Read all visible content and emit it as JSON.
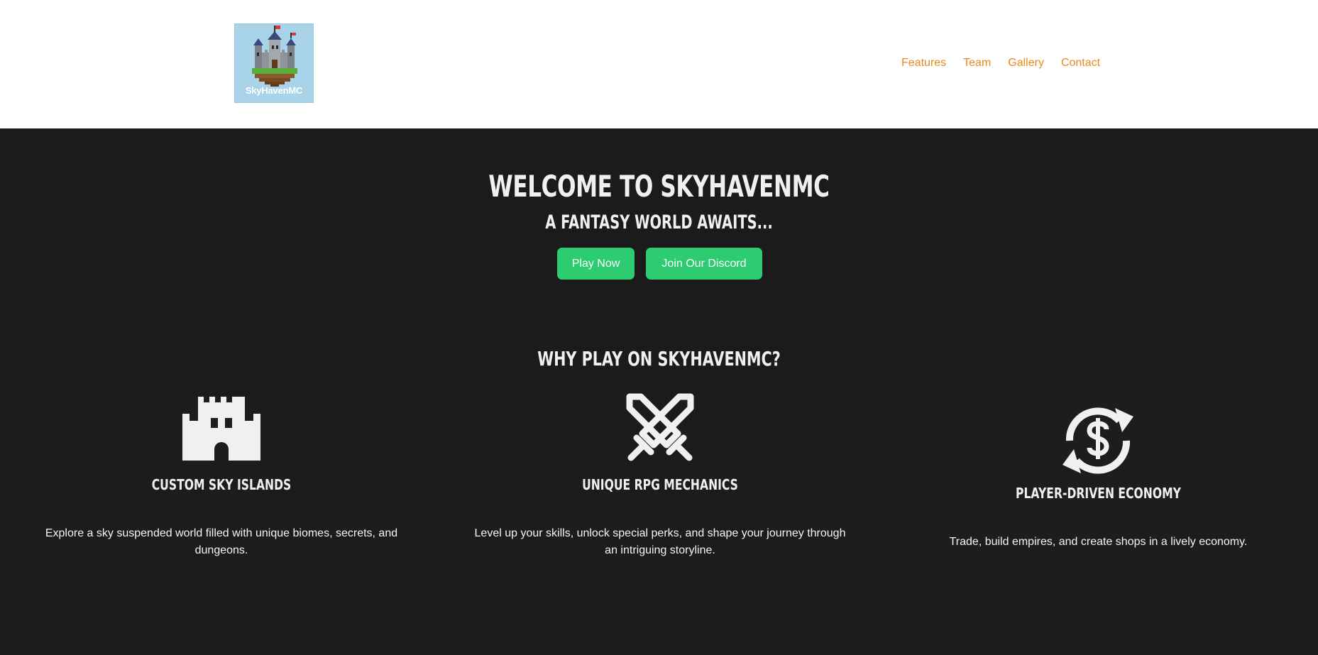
{
  "header": {
    "logo_text": "SkyHavenMC",
    "nav": [
      {
        "label": "Features"
      },
      {
        "label": "Team"
      },
      {
        "label": "Gallery"
      },
      {
        "label": "Contact"
      }
    ]
  },
  "hero": {
    "title": "WELCOME TO SKYHAVENMC",
    "subtitle": "A FANTASY WORLD AWAITS...",
    "buttons": {
      "play_label": "Play Now",
      "discord_label": "Join Our Discord"
    }
  },
  "features": {
    "heading": "WHY PLAY ON SKYHAVENMC?",
    "cards": [
      {
        "icon": "castle-icon",
        "title": "CUSTOM SKY ISLANDS",
        "description": "Explore a sky suspended world filled with unique biomes, secrets, and dungeons."
      },
      {
        "icon": "crossed-swords-icon",
        "title": "UNIQUE RPG MECHANICS",
        "description": "Level up your skills, unlock special perks, and shape your journey through an intriguing storyline."
      },
      {
        "icon": "dollar-exchange-icon",
        "title": "PLAYER-DRIVEN ECONOMY",
        "description": "Trade, build empires, and create shops in a lively economy."
      }
    ]
  },
  "colors": {
    "nav_link": "#e8891a",
    "button": "#2ecc71",
    "background": "#1b1b1b",
    "header_bg": "#ffffff"
  }
}
